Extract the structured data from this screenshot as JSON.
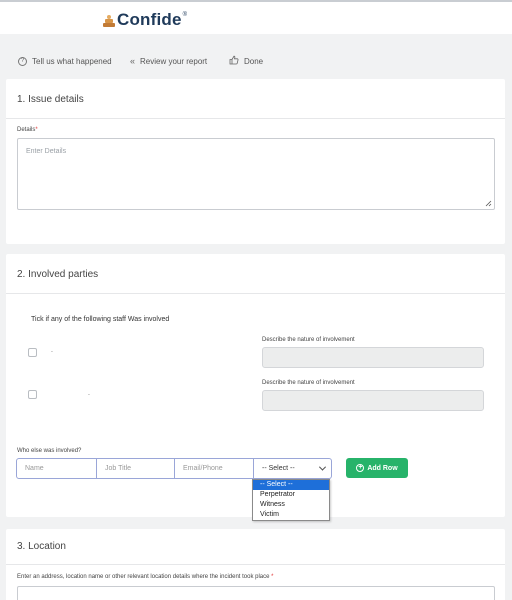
{
  "header": {
    "logo_text": "Confide",
    "logo_reg": "®"
  },
  "steps": [
    {
      "label": "Tell us what happened",
      "icon": "question-circle-icon"
    },
    {
      "label": "Review your report",
      "icon": "double-chevron-left-icon"
    },
    {
      "label": "Done",
      "icon": "thumbs-up-icon"
    }
  ],
  "issue_details": {
    "title": "1. Issue details",
    "details_label": "Details",
    "required_mark": "*",
    "details_placeholder": "Enter Details"
  },
  "involved_parties": {
    "title": "2. Involved parties",
    "tick_text": "Tick if any of the following staff Was involved",
    "staff": [
      {
        "name": ".",
        "describe_label": "Describe the nature of involvement"
      },
      {
        "name": ".",
        "describe_label": "Describe the nature of involvement"
      }
    ],
    "who_else_label": "Who else was involved?",
    "row_placeholders": {
      "name": "Name",
      "job_title": "Job Title",
      "email_phone": "Email/Phone"
    },
    "role_select_value": "-- Select --",
    "role_options": [
      "-- Select --",
      "Perpetrator",
      "Witness",
      "Victim"
    ],
    "add_row_label": "Add Row"
  },
  "location": {
    "title": "3. Location",
    "address_label": "Enter an address, location name or other relevant location details where the incident took place",
    "required_mark": "*"
  }
}
